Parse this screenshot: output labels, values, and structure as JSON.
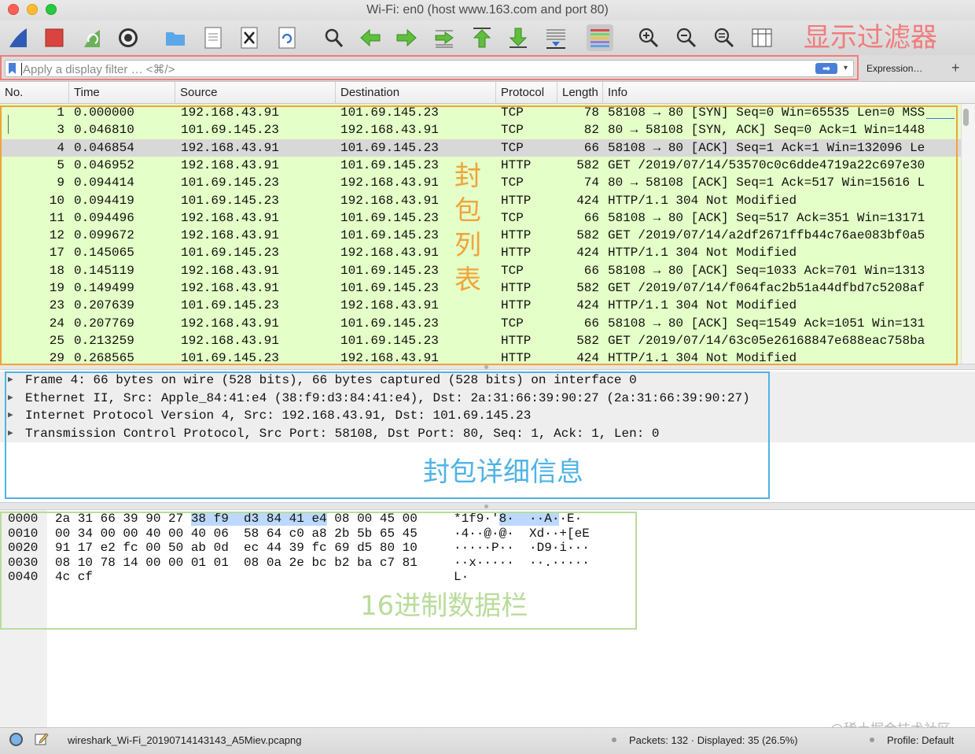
{
  "window": {
    "title": "Wi-Fi: en0 (host www.163.com and port 80)"
  },
  "toolbar": {
    "icons": [
      "shark-fin-start-icon",
      "stop-capture-icon",
      "restart-capture-icon",
      "capture-options-icon",
      "open-file-icon",
      "save-file-icon",
      "close-file-icon",
      "reload-file-icon",
      "find-packet-icon",
      "go-back-icon",
      "go-forward-icon",
      "go-to-packet-icon",
      "go-first-packet-icon",
      "go-last-packet-icon",
      "auto-scroll-icon",
      "colorize-icon",
      "zoom-in-icon",
      "zoom-out-icon",
      "zoom-normal-icon",
      "resize-columns-icon"
    ]
  },
  "filter": {
    "placeholder": "Apply a display filter … <⌘/>",
    "expression_label": "Expression…",
    "add_label": "+",
    "apply_arrow": "➡"
  },
  "columns": {
    "no": "No.",
    "time": "Time",
    "source": "Source",
    "destination": "Destination",
    "protocol": "Protocol",
    "length": "Length",
    "info": "Info"
  },
  "packets": [
    {
      "no": "1",
      "time": "0.000000",
      "src": "192.168.43.91",
      "dst": "101.69.145.23",
      "proto": "TCP",
      "len": "78",
      "info": "58108 → 80 [SYN] Seq=0 Win=65535 Len=0 MSS"
    },
    {
      "no": "3",
      "time": "0.046810",
      "src": "101.69.145.23",
      "dst": "192.168.43.91",
      "proto": "TCP",
      "len": "82",
      "info": "80 → 58108 [SYN, ACK] Seq=0 Ack=1 Win=1448"
    },
    {
      "no": "4",
      "time": "0.046854",
      "src": "192.168.43.91",
      "dst": "101.69.145.23",
      "proto": "TCP",
      "len": "66",
      "info": "58108 → 80 [ACK] Seq=1 Ack=1 Win=132096 Le"
    },
    {
      "no": "5",
      "time": "0.046952",
      "src": "192.168.43.91",
      "dst": "101.69.145.23",
      "proto": "HTTP",
      "len": "582",
      "info": "GET /2019/07/14/53570c0c6dde4719a22c697e30"
    },
    {
      "no": "9",
      "time": "0.094414",
      "src": "101.69.145.23",
      "dst": "192.168.43.91",
      "proto": "TCP",
      "len": "74",
      "info": "80 → 58108 [ACK] Seq=1 Ack=517 Win=15616 L"
    },
    {
      "no": "10",
      "time": "0.094419",
      "src": "101.69.145.23",
      "dst": "192.168.43.91",
      "proto": "HTTP",
      "len": "424",
      "info": "HTTP/1.1 304 Not Modified"
    },
    {
      "no": "11",
      "time": "0.094496",
      "src": "192.168.43.91",
      "dst": "101.69.145.23",
      "proto": "TCP",
      "len": "66",
      "info": "58108 → 80 [ACK] Seq=517 Ack=351 Win=13171"
    },
    {
      "no": "12",
      "time": "0.099672",
      "src": "192.168.43.91",
      "dst": "101.69.145.23",
      "proto": "HTTP",
      "len": "582",
      "info": "GET /2019/07/14/a2df2671ffb44c76ae083bf0a5"
    },
    {
      "no": "17",
      "time": "0.145065",
      "src": "101.69.145.23",
      "dst": "192.168.43.91",
      "proto": "HTTP",
      "len": "424",
      "info": "HTTP/1.1 304 Not Modified"
    },
    {
      "no": "18",
      "time": "0.145119",
      "src": "192.168.43.91",
      "dst": "101.69.145.23",
      "proto": "TCP",
      "len": "66",
      "info": "58108 → 80 [ACK] Seq=1033 Ack=701 Win=1313"
    },
    {
      "no": "19",
      "time": "0.149499",
      "src": "192.168.43.91",
      "dst": "101.69.145.23",
      "proto": "HTTP",
      "len": "582",
      "info": "GET /2019/07/14/f064fac2b51a44dfbd7c5208af"
    },
    {
      "no": "23",
      "time": "0.207639",
      "src": "101.69.145.23",
      "dst": "192.168.43.91",
      "proto": "HTTP",
      "len": "424",
      "info": "HTTP/1.1 304 Not Modified"
    },
    {
      "no": "24",
      "time": "0.207769",
      "src": "192.168.43.91",
      "dst": "101.69.145.23",
      "proto": "TCP",
      "len": "66",
      "info": "58108 → 80 [ACK] Seq=1549 Ack=1051 Win=131"
    },
    {
      "no": "25",
      "time": "0.213259",
      "src": "192.168.43.91",
      "dst": "101.69.145.23",
      "proto": "HTTP",
      "len": "582",
      "info": "GET /2019/07/14/63c05e26168847e688eac758ba"
    },
    {
      "no": "29",
      "time": "0.268565",
      "src": "101.69.145.23",
      "dst": "192.168.43.91",
      "proto": "HTTP",
      "len": "424",
      "info": "HTTP/1.1 304 Not Modified"
    }
  ],
  "details": [
    "Frame 4: 66 bytes on wire (528 bits), 66 bytes captured (528 bits) on interface 0",
    "Ethernet II, Src: Apple_84:41:e4 (38:f9:d3:84:41:e4), Dst: 2a:31:66:39:90:27 (2a:31:66:39:90:27)",
    "Internet Protocol Version 4, Src: 192.168.43.91, Dst: 101.69.145.23",
    "Transmission Control Protocol, Src Port: 58108, Dst Port: 80, Seq: 1, Ack: 1, Len: 0"
  ],
  "hex": [
    {
      "offset": "0000",
      "pre": "2a 31 66 39 90 27 ",
      "hl": "38 f9  d3 84 41 e4",
      "post": " 08 00 45 00",
      "ascii_pre": "*1f9·'",
      "ascii_hl": "8·  ··A·",
      "ascii_post": "·E·"
    },
    {
      "offset": "0010",
      "pre": "00 34 00 00 40 00 40 06  58 64 c0 a8 2b 5b 65 45",
      "hl": "",
      "post": "",
      "ascii_pre": "·4··@·@·  Xd··+[eE",
      "ascii_hl": "",
      "ascii_post": ""
    },
    {
      "offset": "0020",
      "pre": "91 17 e2 fc 00 50 ab 0d  ec 44 39 fc 69 d5 80 10",
      "hl": "",
      "post": "",
      "ascii_pre": "·····P··  ·D9·i···",
      "ascii_hl": "",
      "ascii_post": ""
    },
    {
      "offset": "0030",
      "pre": "08 10 78 14 00 00 01 01  08 0a 2e bc b2 ba c7 81",
      "hl": "",
      "post": "",
      "ascii_pre": "··x·····  ··.·····",
      "ascii_hl": "",
      "ascii_post": ""
    },
    {
      "offset": "0040",
      "pre": "4c cf",
      "hl": "",
      "post": "",
      "ascii_pre": "L·",
      "ascii_hl": "",
      "ascii_post": ""
    }
  ],
  "annotations": {
    "filter_label": "显示过滤器",
    "packet_list_label": "封包列表",
    "detail_label": "封包详细信息",
    "hex_label": "16进制数据栏",
    "filter_color": "#f27c7c",
    "packet_list_color": "#f0a43a",
    "detail_color": "#4fb3e6",
    "hex_color": "#b9dc9a"
  },
  "status": {
    "file": "wireshark_Wi-Fi_20190714143143_A5Miev.pcapng",
    "packets": "Packets: 132 · Displayed: 35 (26.5%)",
    "profile": "Profile: Default",
    "watermark": "@稀土掘金技术社区"
  },
  "colors": {
    "row_bg": "#e4ffc7",
    "selected_bg": "#d8d8d8",
    "hex_highlight": "#bcd8fc"
  }
}
